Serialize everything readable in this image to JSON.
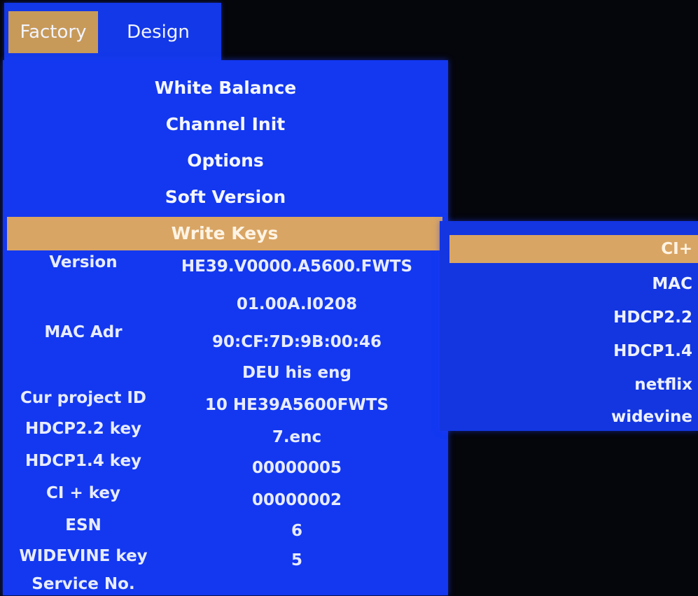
{
  "tabs": {
    "factory": "Factory",
    "design": "Design",
    "active": "Factory"
  },
  "menu": {
    "items": [
      "White Balance",
      "Channel Init",
      "Options",
      "Soft Version",
      "Write Keys"
    ],
    "selected": "Write Keys"
  },
  "info": {
    "version_label": "Version",
    "version_value_1": "HE39.V0000.A5600.FWTS",
    "version_value_2": "01.00A.I0208",
    "mac_label": "MAC Adr",
    "mac_value": "90:CF:7D:9B:00:46",
    "lang_value": "DEU his eng",
    "project_label": "Cur project ID",
    "project_value": "10 HE39A5600FWTS",
    "hdcp22_label": "HDCP2.2 key",
    "hdcp22_value": "7.enc",
    "hdcp14_label": "HDCP1.4 key",
    "hdcp14_value": "00000005",
    "ci_label": "CI + key",
    "ci_value": "00000002",
    "esn_label": "ESN",
    "esn_value": "6",
    "widevine_label": "WIDEVINE key",
    "widevine_value": "5",
    "service_label": "Service No."
  },
  "submenu": {
    "items": [
      "CI+",
      "MAC",
      "HDCP2.2",
      "HDCP1.4",
      "netflix",
      "widevine"
    ],
    "selected": "CI+"
  },
  "colors": {
    "panel_blue": "#1338f0",
    "highlight": "#d9a564",
    "background": "#05060c"
  }
}
